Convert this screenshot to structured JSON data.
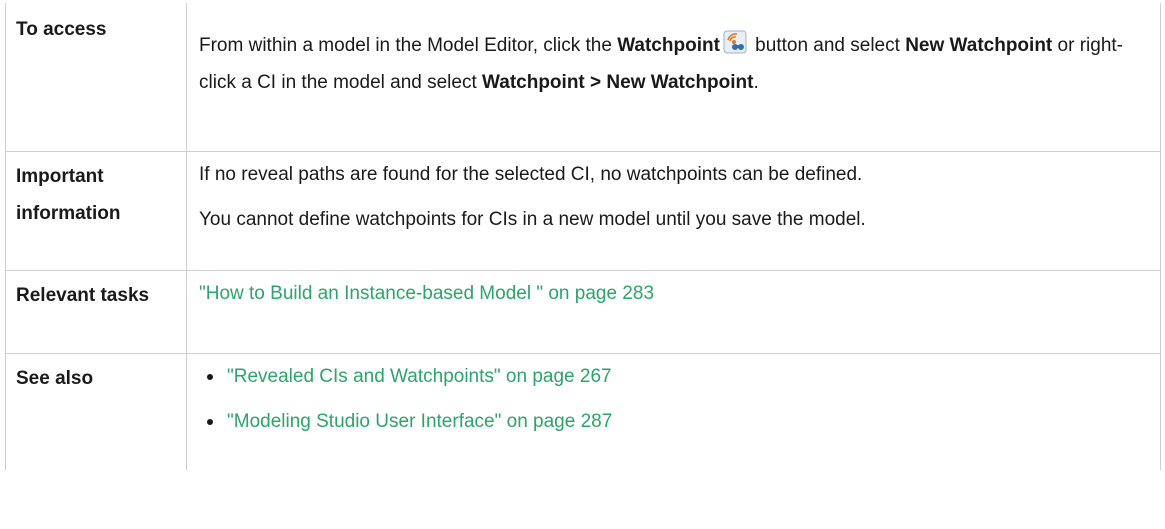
{
  "rows": {
    "access": {
      "label": "To access",
      "text1": "From within a model in the Model Editor, click the ",
      "bold1": "Watchpoint",
      "text2": " button and select ",
      "bold2": "New Watchpoint",
      "text3": " or right-click a CI in the model and select ",
      "bold3": "Watchpoint > New Watchpoint",
      "text4": "."
    },
    "important": {
      "label": "Important information",
      "paragraphs": [
        "If no reveal paths are found for the selected CI, no watchpoints can be defined.",
        "You cannot define watchpoints for CIs in a new model until you save the model."
      ]
    },
    "tasks": {
      "label": "Relevant tasks",
      "link": "\"How to Build an Instance-based Model \" on page 283"
    },
    "see_also": {
      "label": "See also",
      "links": [
        "\"Revealed CIs and Watchpoints\" on page 267",
        "\"Modeling Studio User Interface\" on page 287"
      ]
    }
  },
  "colors": {
    "link": "#2aa56b",
    "border": "#cfcfcf",
    "text": "#1a1a1a"
  },
  "icons": {
    "watchpoint": "watchpoint-icon"
  }
}
